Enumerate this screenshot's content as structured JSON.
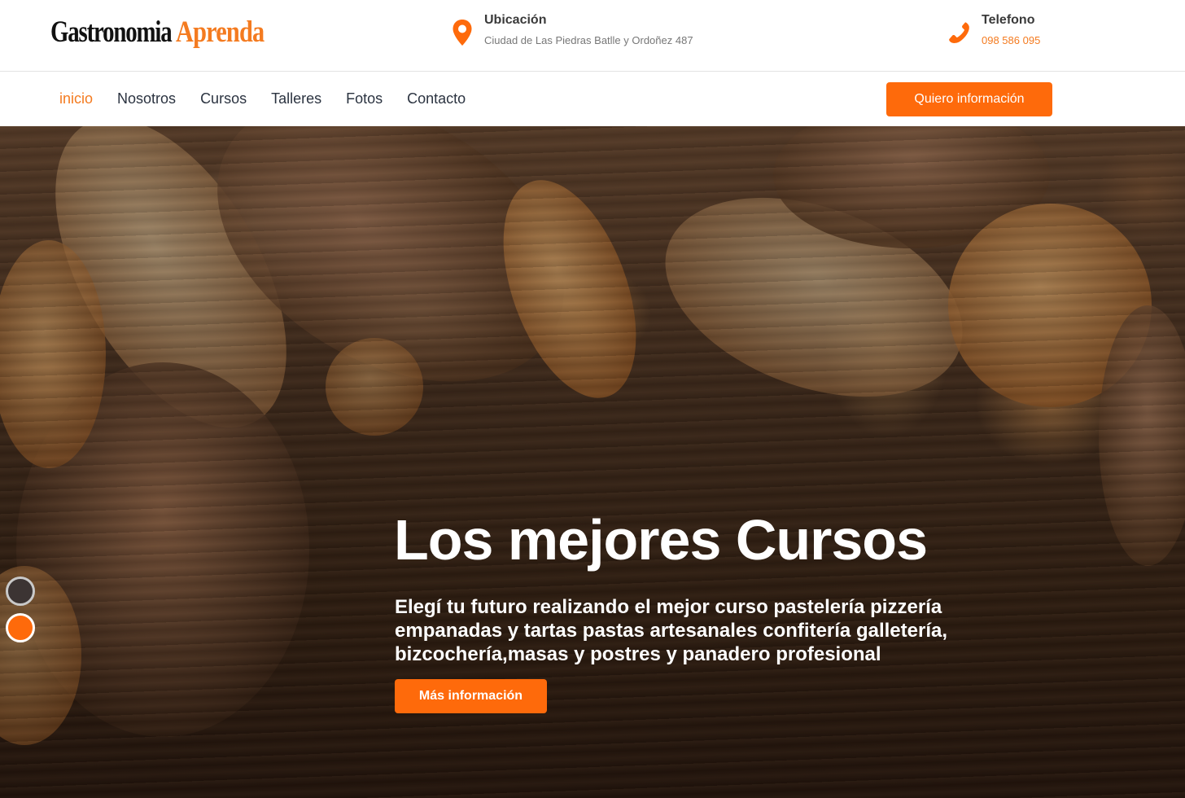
{
  "header": {
    "logo": {
      "part1": "Gastronomia",
      "part2": "Aprenda"
    },
    "location": {
      "title": "Ubicación",
      "value": "Ciudad de Las Piedras Batlle y Ordoñez 487",
      "icon": "map-pin-icon"
    },
    "phone": {
      "title": "Telefono",
      "value": "098 586 095",
      "icon": "phone-icon"
    }
  },
  "nav": {
    "items": [
      {
        "label": "inicio",
        "active": true
      },
      {
        "label": "Nosotros"
      },
      {
        "label": "Cursos"
      },
      {
        "label": "Talleres"
      },
      {
        "label": "Fotos"
      },
      {
        "label": "Contacto"
      }
    ],
    "cta_label": "Quiero información"
  },
  "hero": {
    "title": "Los mejores Cursos",
    "text": "Elegí tu futuro realizando el mejor curso pastelería pizzería empanadas y tartas pastas artesanales confitería galletería, bizcochería,masas y postres y panadero profesional",
    "button_label": "Más información",
    "slides": 2,
    "active_slide": 2
  },
  "colors": {
    "accent": "#fe6a0b",
    "brand_orange": "#f47b20",
    "nav_text": "#2b3340",
    "white": "#ffffff"
  }
}
